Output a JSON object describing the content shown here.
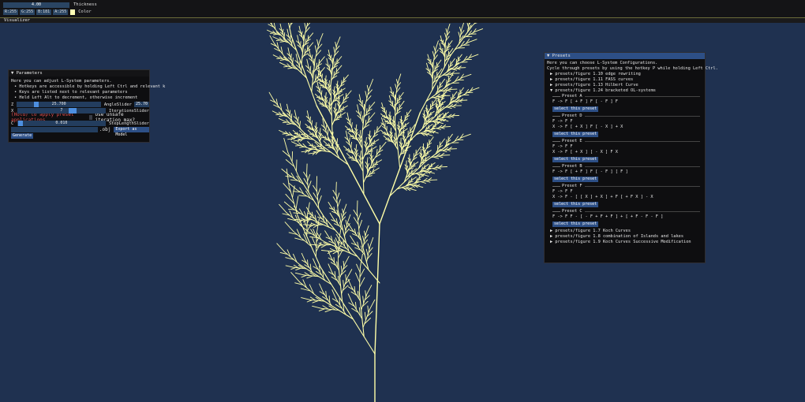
{
  "topbar": {
    "thickness_value": "4.00",
    "thickness_label": "Thickness",
    "color": {
      "r": "R:255",
      "g": "G:255",
      "b": "B:181",
      "a": "A:255",
      "label": "Color",
      "swatch": "#ffffb5"
    }
  },
  "window": {
    "title": "Visualizer"
  },
  "parameters": {
    "title": "Parameters",
    "lines": [
      "Here you can adjust L-System parameters.",
      "Hotkeys are accessible by holding Left Ctrl and relevant k",
      "Keys are listed next to relevant parameters",
      "Held Left Alt to decrement, otherwise increment"
    ],
    "angle": {
      "key": "Z",
      "value": "25.700",
      "label": "AngleSlider",
      "extra": "25.70",
      "fill": 0.19
    },
    "iterations": {
      "key": "X",
      "value": "7",
      "label": "IterationsSlider",
      "fill": 0.62
    },
    "warning": "(Hold) to apply preset applications",
    "unsafe_label": "Use unsafe iteration max?",
    "step": {
      "key": "C",
      "value": "0.010",
      "label": "StepLengthSlider",
      "fill": 0.0
    },
    "obj_suffix": ".obj",
    "export_label": "Export as Model",
    "generate_label": "Generate"
  },
  "presets": {
    "title": "Presets",
    "intro": [
      "Here you can choose L-System Configurations.",
      "Cycle through presets by using the hotkey P while holding Left Ctrl."
    ],
    "collapsed_top": [
      "presets/figure 1.10 edge rewriting",
      "presets/figure 1.11 FASS curves",
      "presets/figure 1.13 Hilbert Curve"
    ],
    "open_item": "presets/figure 1.24 bracketed OL-systems",
    "sections": [
      {
        "name": "Preset A",
        "rules": [
          "F  ->  F [ + F ] F [ - F ] F"
        ]
      },
      {
        "name": "Preset D",
        "rules": [
          "F  ->  F F",
          "X  ->  F [ + X ] F [ - X ] + X"
        ]
      },
      {
        "name": "Preset E",
        "rules": [
          "F  ->  F F",
          "X  ->  F [ + X ] [ - X ] F X"
        ]
      },
      {
        "name": "Preset B",
        "rules": [
          "F  ->  F [ + F ] F [ - F ] [ F ]"
        ]
      },
      {
        "name": "Preset F",
        "rules": [
          "F  ->  F F",
          "X  ->  F - [ [ X ] + X ] + F [ + F X ] - X"
        ]
      },
      {
        "name": "Preset C",
        "rules": [
          "F  ->  F F - [ - F + F + F ] + [ + F - F - F ]"
        ]
      }
    ],
    "select_label": "select this preset",
    "collapsed_bottom": [
      "presets/figure 1.7 Koch Curves",
      "presets/figure 1.8 combination of Islands and lakes",
      "presets/figure 1.9 Koch Curves Successive Modification"
    ]
  },
  "colors": {
    "background": "#1f3150",
    "stroke": "#ffffa8",
    "accent": "#2d4f86"
  }
}
